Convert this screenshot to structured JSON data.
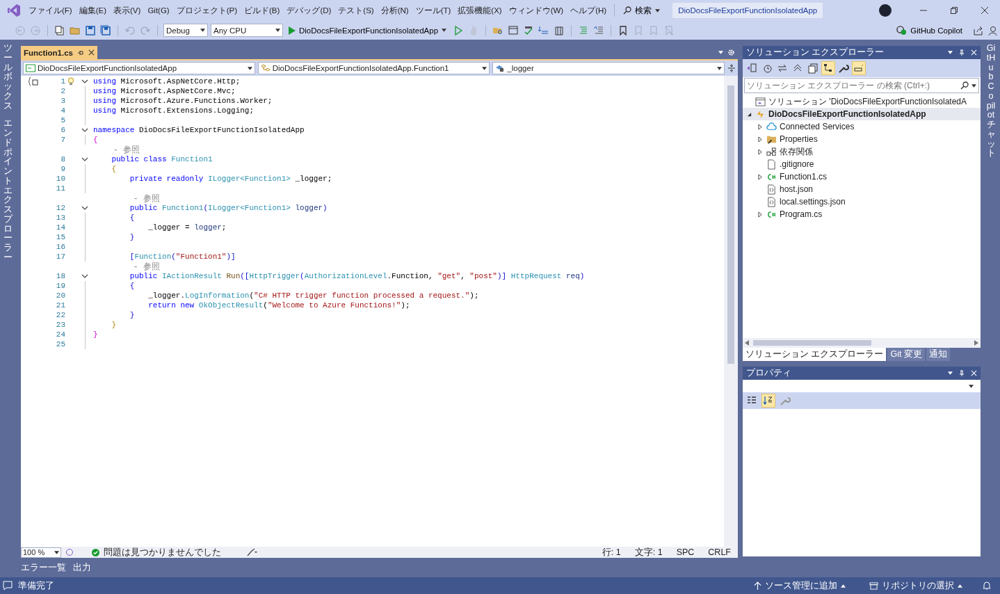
{
  "menu": [
    "ファイル(F)",
    "編集(E)",
    "表示(V)",
    "Git(G)",
    "プロジェクト(P)",
    "ビルド(B)",
    "デバッグ(D)",
    "テスト(S)",
    "分析(N)",
    "ツール(T)",
    "拡張機能(X)",
    "ウィンドウ(W)",
    "ヘルプ(H)"
  ],
  "search": {
    "label": "検索"
  },
  "window": {
    "title": "DioDocsFileExportFunctionIsolatedApp"
  },
  "toolbar": {
    "configuration": "Debug",
    "platform": "Any CPU",
    "startup_project": "DioDocsFileExportFunctionIsolatedApp",
    "copilot": "GitHub Copilot"
  },
  "left_tool_tabs": [
    "ツールボックス",
    "エンドポイントエクスプローラー"
  ],
  "right_tool_tabs": [
    "GitHub Copilot チャット"
  ],
  "editor": {
    "tabs": [
      {
        "label": "Function1.cs",
        "selected": true
      }
    ],
    "nav": [
      "DioDocsFileExportFunctionIsolatedApp",
      "DioDocsFileExportFunctionIsolatedApp.Function1",
      "_logger"
    ],
    "lines": [
      {
        "kind": "code",
        "number": "1",
        "fold": true,
        "tokens": [
          {
            "kind": "kw",
            "text": "using"
          },
          {
            "kind": "text",
            "text": " Microsoft.AspNetCore.Http;"
          }
        ]
      },
      {
        "kind": "code",
        "number": "2",
        "fold": false,
        "tokens": [
          {
            "kind": "kw",
            "text": "using"
          },
          {
            "kind": "text",
            "text": " Microsoft.AspNetCore.Mvc;"
          }
        ]
      },
      {
        "kind": "code",
        "number": "3",
        "fold": false,
        "tokens": [
          {
            "kind": "kw",
            "text": "using"
          },
          {
            "kind": "text",
            "text": " Microsoft.Azure.Functions.Worker;"
          }
        ]
      },
      {
        "kind": "code",
        "number": "4",
        "fold": false,
        "tokens": [
          {
            "kind": "kw",
            "text": "using"
          },
          {
            "kind": "text",
            "text": " Microsoft.Extensions.Logging;"
          }
        ]
      },
      {
        "kind": "code",
        "number": "5",
        "fold": false
      },
      {
        "kind": "code",
        "number": "6",
        "fold": true,
        "tokens": [
          {
            "kind": "kw",
            "text": "namespace"
          },
          {
            "kind": "text",
            "text": " DioDocsFileExportFunctionIsolatedApp"
          }
        ]
      },
      {
        "kind": "code",
        "number": "7",
        "fold": false,
        "tokens": [
          {
            "kind": "b1",
            "text": "{"
          }
        ]
      },
      {
        "kind": "codelens",
        "text": "    - 参照"
      },
      {
        "kind": "code",
        "number": "8",
        "fold": true,
        "tokens": [
          {
            "kind": "kw",
            "text": "    public class"
          },
          {
            "kind": "type",
            "text": " Function1"
          }
        ]
      },
      {
        "kind": "code",
        "number": "9",
        "fold": false,
        "tokens": [
          {
            "kind": "b2",
            "text": "    {"
          }
        ]
      },
      {
        "kind": "code",
        "number": "10",
        "fold": false,
        "tokens": [
          {
            "kind": "kw",
            "text": "        private readonly"
          },
          {
            "kind": "type",
            "text": " ILogger<Function1>"
          },
          {
            "kind": "text",
            "text": " _logger;"
          }
        ]
      },
      {
        "kind": "code",
        "number": "11",
        "fold": false
      },
      {
        "kind": "codelens",
        "text": "        - 参照"
      },
      {
        "kind": "code",
        "number": "12",
        "fold": true,
        "tokens": [
          {
            "kind": "kw",
            "text": "        public"
          },
          {
            "kind": "type",
            "text": " Function1"
          },
          {
            "kind": "b3",
            "text": "("
          },
          {
            "kind": "type",
            "text": "ILogger<Function1>"
          },
          {
            "kind": "param",
            "text": " logger"
          },
          {
            "kind": "b3",
            "text": ")"
          }
        ]
      },
      {
        "kind": "code",
        "number": "13",
        "fold": false,
        "tokens": [
          {
            "kind": "b3",
            "text": "        {"
          }
        ]
      },
      {
        "kind": "code",
        "number": "14",
        "fold": false,
        "tokens": [
          {
            "kind": "text",
            "text": "            _logger = "
          },
          {
            "kind": "param",
            "text": "logger"
          },
          {
            "kind": "text",
            "text": ";"
          }
        ]
      },
      {
        "kind": "code",
        "number": "15",
        "fold": false,
        "tokens": [
          {
            "kind": "b3",
            "text": "        }"
          }
        ]
      },
      {
        "kind": "code",
        "number": "16",
        "fold": false
      },
      {
        "kind": "code",
        "number": "17",
        "fold": false,
        "tokens": [
          {
            "kind": "b3",
            "text": "        ["
          },
          {
            "kind": "type",
            "text": "Function"
          },
          {
            "kind": "b3",
            "text": "("
          },
          {
            "kind": "str",
            "text": "\"Function1\""
          },
          {
            "kind": "b3",
            "text": ")]"
          }
        ]
      },
      {
        "kind": "codelens",
        "text": "        - 参照"
      },
      {
        "kind": "code",
        "number": "18",
        "fold": true,
        "tokens": [
          {
            "kind": "kw",
            "text": "        public"
          },
          {
            "kind": "type",
            "text": " IActionResult"
          },
          {
            "kind": "method",
            "text": " Run"
          },
          {
            "kind": "b3",
            "text": "(["
          },
          {
            "kind": "type",
            "text": "HttpTrigger"
          },
          {
            "kind": "b3",
            "text": "("
          },
          {
            "kind": "type",
            "text": "AuthorizationLevel"
          },
          {
            "kind": "text",
            "text": ".Function, "
          },
          {
            "kind": "str",
            "text": "\"get\""
          },
          {
            "kind": "text",
            "text": ", "
          },
          {
            "kind": "str",
            "text": "\"post\""
          },
          {
            "kind": "b3",
            "text": ")]"
          },
          {
            "kind": "type",
            "text": " HttpRequest"
          },
          {
            "kind": "param",
            "text": " req"
          },
          {
            "kind": "b3",
            "text": ")"
          }
        ]
      },
      {
        "kind": "code",
        "number": "19",
        "fold": false,
        "tokens": [
          {
            "kind": "b3",
            "text": "        {"
          }
        ]
      },
      {
        "kind": "code",
        "number": "20",
        "fold": false,
        "tokens": [
          {
            "kind": "text",
            "text": "            _logger."
          },
          {
            "kind": "type",
            "text": "LogInformation"
          },
          {
            "kind": "text",
            "text": "("
          },
          {
            "kind": "str",
            "text": "\"C# HTTP trigger function processed a request.\""
          },
          {
            "kind": "text",
            "text": ");"
          }
        ]
      },
      {
        "kind": "code",
        "number": "21",
        "fold": false,
        "tokens": [
          {
            "kind": "kw",
            "text": "            return new"
          },
          {
            "kind": "type",
            "text": " OkObjectResult"
          },
          {
            "kind": "text",
            "text": "("
          },
          {
            "kind": "str",
            "text": "\"Welcome to Azure Functions!\""
          },
          {
            "kind": "text",
            "text": ");"
          }
        ]
      },
      {
        "kind": "code",
        "number": "22",
        "fold": false,
        "tokens": [
          {
            "kind": "b3",
            "text": "        }"
          }
        ]
      },
      {
        "kind": "code",
        "number": "23",
        "fold": false,
        "tokens": [
          {
            "kind": "b2",
            "text": "    }"
          }
        ]
      },
      {
        "kind": "code",
        "number": "24",
        "fold": false,
        "tokens": [
          {
            "kind": "b1",
            "text": "}"
          }
        ]
      },
      {
        "kind": "code",
        "number": "25",
        "fold": false
      }
    ],
    "zoom": "100 %",
    "issues": "問題は見つかりませんでした",
    "position": [
      "行: 1",
      "文字: 1",
      "SPC",
      "CRLF"
    ]
  },
  "bottom_tabs": [
    "エラー一覧",
    "出力"
  ],
  "solution_explorer": {
    "title": "ソリューション エクスプローラー",
    "search_placeholder": "ソリューション エクスプローラー の検索 (Ctrl+:)",
    "tree": [
      {
        "label": "ソリューション 'DioDocsFileExportFunctionIsolatedA",
        "kind": "solution",
        "selected": false
      },
      {
        "label": "DioDocsFileExportFunctionIsolatedApp",
        "kind": "project",
        "selected": true,
        "expanded": true,
        "children": [
          {
            "label": "Connected Services",
            "kind": "services",
            "selected": false,
            "expanded": false
          },
          {
            "label": "Properties",
            "kind": "properties",
            "selected": false,
            "expanded": false
          },
          {
            "label": "依存関係",
            "kind": "dependencies",
            "selected": false,
            "expanded": false
          },
          {
            "label": ".gitignore",
            "kind": "file",
            "selected": false
          },
          {
            "label": "Function1.cs",
            "kind": "csharp",
            "selected": false,
            "expanded": false
          },
          {
            "label": "host.json",
            "kind": "json",
            "selected": false
          },
          {
            "label": "local.settings.json",
            "kind": "json",
            "selected": false
          },
          {
            "label": "Program.cs",
            "kind": "csharp",
            "selected": false,
            "expanded": false
          }
        ]
      }
    ]
  },
  "panel_tabs": [
    {
      "label": "ソリューション エクスプローラー",
      "selected": true
    },
    {
      "label": "Git 変更",
      "selected": false
    },
    {
      "label": "通知",
      "selected": false
    }
  ],
  "properties": {
    "title": "プロパティ"
  },
  "status_bar": {
    "state": "準備完了",
    "source_control": "ソース管理に追加",
    "repository": "リポジトリの選択"
  }
}
